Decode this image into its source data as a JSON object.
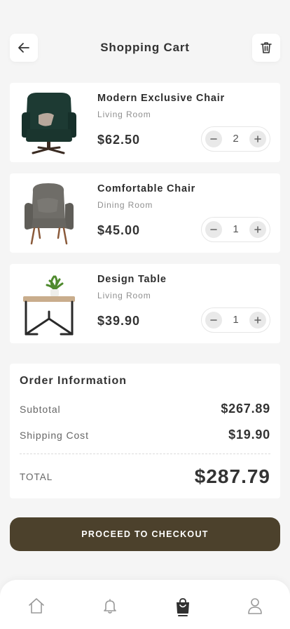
{
  "header": {
    "title": "Shopping Cart",
    "back_icon": "arrow-left-icon",
    "delete_icon": "trash-icon"
  },
  "cart": {
    "items": [
      {
        "name": "Modern Exclusive Chair",
        "category": "Living Room",
        "price": "$62.50",
        "quantity": "2",
        "image": "lounge-chair-image"
      },
      {
        "name": "Comfortable Chair",
        "category": "Dining Room",
        "price": "$45.00",
        "quantity": "1",
        "image": "armchair-image"
      },
      {
        "name": "Design Table",
        "category": "Living Room",
        "price": "$39.90",
        "quantity": "1",
        "image": "side-table-image"
      }
    ]
  },
  "order": {
    "heading": "Order Information",
    "subtotal_label": "Subtotal",
    "subtotal_value": "$267.89",
    "shipping_label": "Shipping Cost",
    "shipping_value": "$19.90",
    "total_label": "TOTAL",
    "total_value": "$287.79"
  },
  "checkout": {
    "label": "PROCEED TO CHECKOUT"
  },
  "nav": {
    "items": [
      "home-icon",
      "bell-icon",
      "shopping-bag-icon",
      "user-icon"
    ],
    "active": "shopping-bag-icon"
  },
  "colors": {
    "accent": "#4c412c",
    "background": "#f5f5f5"
  }
}
